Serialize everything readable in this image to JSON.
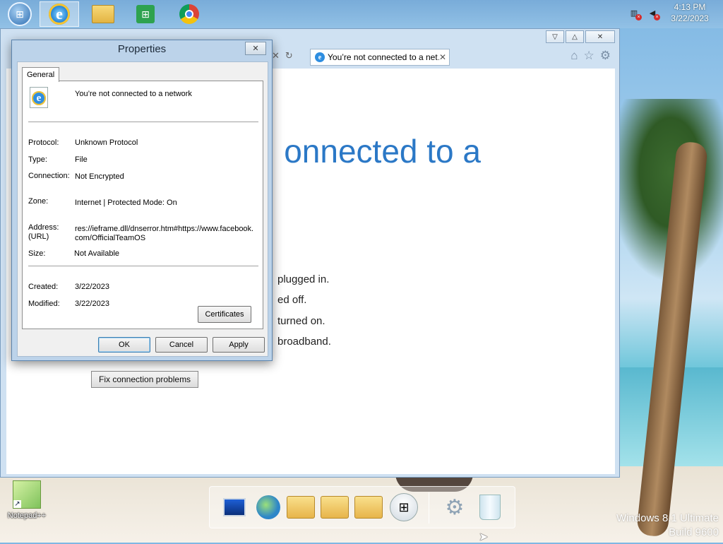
{
  "taskbar": {
    "clock_time": "4:13 PM",
    "clock_date": "3/22/2023"
  },
  "browser": {
    "tab_title": "You’re not connected to a net…",
    "heading_partial": "onnected to a",
    "lines": [
      "plugged in.",
      "ed off.",
      "turned on.",
      "broadband."
    ],
    "fix_button": "Fix connection problems"
  },
  "dialog": {
    "title": "Properties",
    "tab": "General",
    "name": "You’re not connected to a network",
    "fields": {
      "protocol_label": "Protocol:",
      "protocol_value": "Unknown Protocol",
      "type_label": "Type:",
      "type_value": "File",
      "connection_label": "Connection:",
      "connection_value": "Not Encrypted",
      "zone_label": "Zone:",
      "zone_value": "Internet | Protected Mode: On",
      "address_label_1": "Address:",
      "address_label_2": "(URL)",
      "address_value_1": "res://ieframe.dll/dnserror.htm#https://www.facebook.",
      "address_value_2": "com/OfficialTeamOS",
      "size_label": "Size:",
      "size_value": "Not Available",
      "created_label": "Created:",
      "created_value": "3/22/2023",
      "modified_label": "Modified:",
      "modified_value": "3/22/2023"
    },
    "certificates_button": "Certificates",
    "ok_button": "OK",
    "cancel_button": "Cancel",
    "apply_button": "Apply"
  },
  "desktop": {
    "icon_label": "Notepad++",
    "watermark_line1": "Windows 8.1 Ultimate",
    "watermark_line2": "Build 9600"
  }
}
